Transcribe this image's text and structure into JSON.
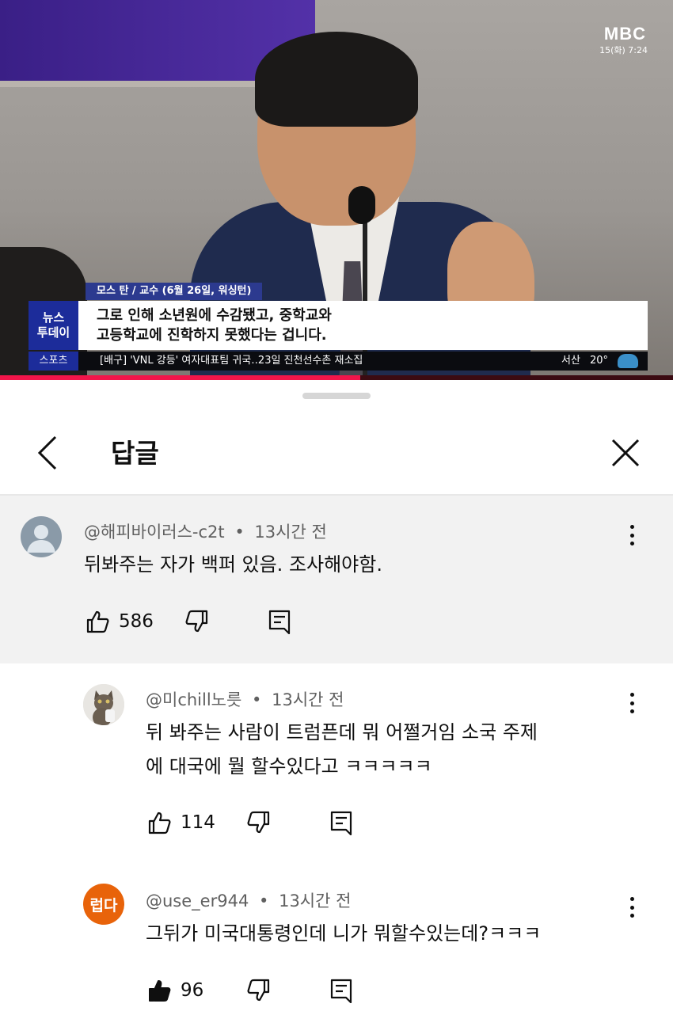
{
  "video": {
    "channel_logo": "MBC",
    "broadcast_time": "15(화) 7:24",
    "name_tag": "모스 탄 / 교수 (6월 26일, 워싱턴)",
    "program_brand_line1": "뉴스",
    "program_brand_line2": "투데이",
    "caption_line1": "그로 인해 소년원에 수감됐고, 중학교와",
    "caption_line2": "고등학교에 진학하지 못했다는 겁니다.",
    "ticker_tag": "스포츠",
    "ticker_text": "[배구] 'VNL 강등' 여자대표팀 귀국‥23일 진천선수촌 재소집",
    "weather_location": "서산",
    "weather_temp": "20°",
    "progress_fraction": 0.535,
    "accent_color": "#f2154a"
  },
  "sheet": {
    "title": "답글",
    "back_icon": "chevron-left-icon",
    "close_icon": "close-icon"
  },
  "parent_comment": {
    "author": "@해피바이러스-c2t",
    "separator": "•",
    "time": "13시간 전",
    "text": "뒤봐주는 자가 백퍼 있음. 조사해야함.",
    "likes": "586",
    "avatar": "default-avatar-icon"
  },
  "replies": [
    {
      "author": "@미chill노릇",
      "separator": "•",
      "time": "13시간 전",
      "text_line1": "뒤 봐주는 사람이 트럼픈데 뭐 어쩔거임 소국 주제",
      "text_line2": "에 대국에 뭘 할수있다고 ㅋㅋㅋㅋㅋ",
      "likes": "114",
      "liked": false,
      "avatar": "cat-photo-avatar"
    },
    {
      "author": "@use_er944",
      "separator": "•",
      "time": "13시간 전",
      "text_line1": "그뒤가 미국대통령인데 니가 뭐할수있는데?ㅋㅋㅋ",
      "likes": "96",
      "liked": true,
      "avatar_text": "럽다",
      "avatar_color": "#e8630a"
    }
  ]
}
